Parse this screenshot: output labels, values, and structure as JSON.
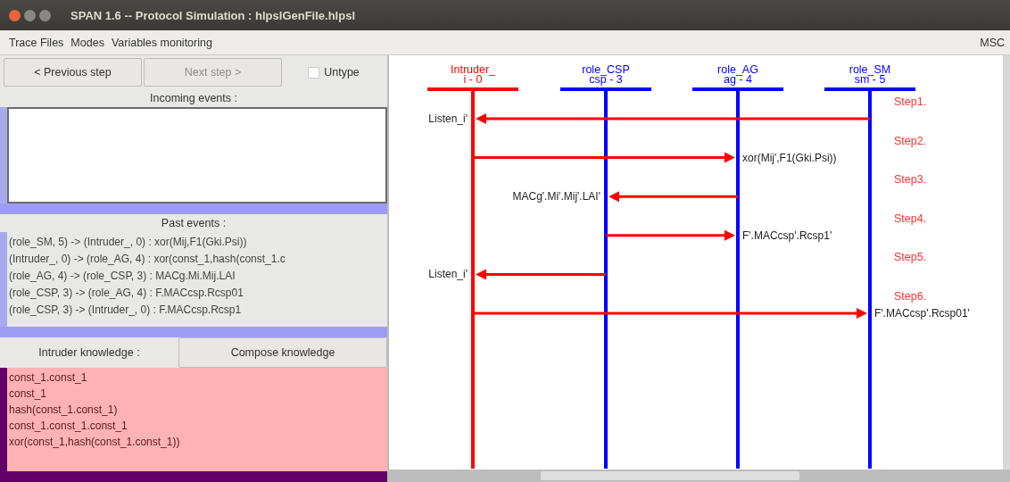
{
  "window": {
    "title": "SPAN 1.6 -- Protocol Simulation : hlpslGenFile.hlpsl"
  },
  "menu": [
    "Trace Files",
    "Modes",
    "Variables monitoring"
  ],
  "menu_right": "MSC",
  "toolbar": {
    "previous": {
      "label": "< Previous step",
      "disabled": false
    },
    "next": {
      "label": "Next step >",
      "disabled": true
    },
    "untype": {
      "label": "Untype",
      "checked": false
    }
  },
  "incoming_events": {
    "title": "Incoming events :"
  },
  "past_events": {
    "title": "Past events :",
    "items": [
      "(role_SM, 5) -> (Intruder_, 0) : xor(Mij,F1(Gki.Psi))",
      "(Intruder_, 0) -> (role_AG, 4) : xor(const_1,hash(const_1.c",
      "(role_AG, 4) -> (role_CSP, 3) : MACg.Mi.Mij.LAI",
      "(role_CSP, 3) -> (role_AG, 4) : F.MACcsp.Rcsp01",
      "(role_CSP, 3) -> (Intruder_, 0) : F.MACcsp.Rcsp1"
    ]
  },
  "knowledge": {
    "title": "Intruder knowledge :",
    "compose": "Compose knowledge",
    "items": [
      "const_1.const_1",
      "const_1",
      "hash(const_1.const_1)",
      "const_1.const_1.const_1",
      "xor(const_1,hash(const_1.const_1))"
    ]
  },
  "diagram": {
    "participants": [
      {
        "name": "Intruder_",
        "id": "i - 0",
        "color": "#ff0000"
      },
      {
        "name": "role_CSP",
        "id": "csp - 3",
        "color": "#0000ff"
      },
      {
        "name": "role_AG",
        "id": "ag - 4",
        "color": "#0000ff"
      },
      {
        "name": "role_SM",
        "id": "sm - 5",
        "color": "#0000ff"
      }
    ],
    "messages": [
      {
        "step": "Step1.",
        "label": "Listen_i'"
      },
      {
        "step": "Step2.",
        "label": "xor(Mij',F1(Gki.Psi))"
      },
      {
        "step": "Step3.",
        "label": "MACg'.Mi'.Mij'.LAI'"
      },
      {
        "step": "Step4.",
        "label": "F'.MACcsp'.Rcsp1'"
      },
      {
        "step": "Step5.",
        "label": "Listen_i'"
      },
      {
        "step": "Step6.",
        "label": "F'.MACcsp'.Rcsp01'"
      }
    ]
  }
}
